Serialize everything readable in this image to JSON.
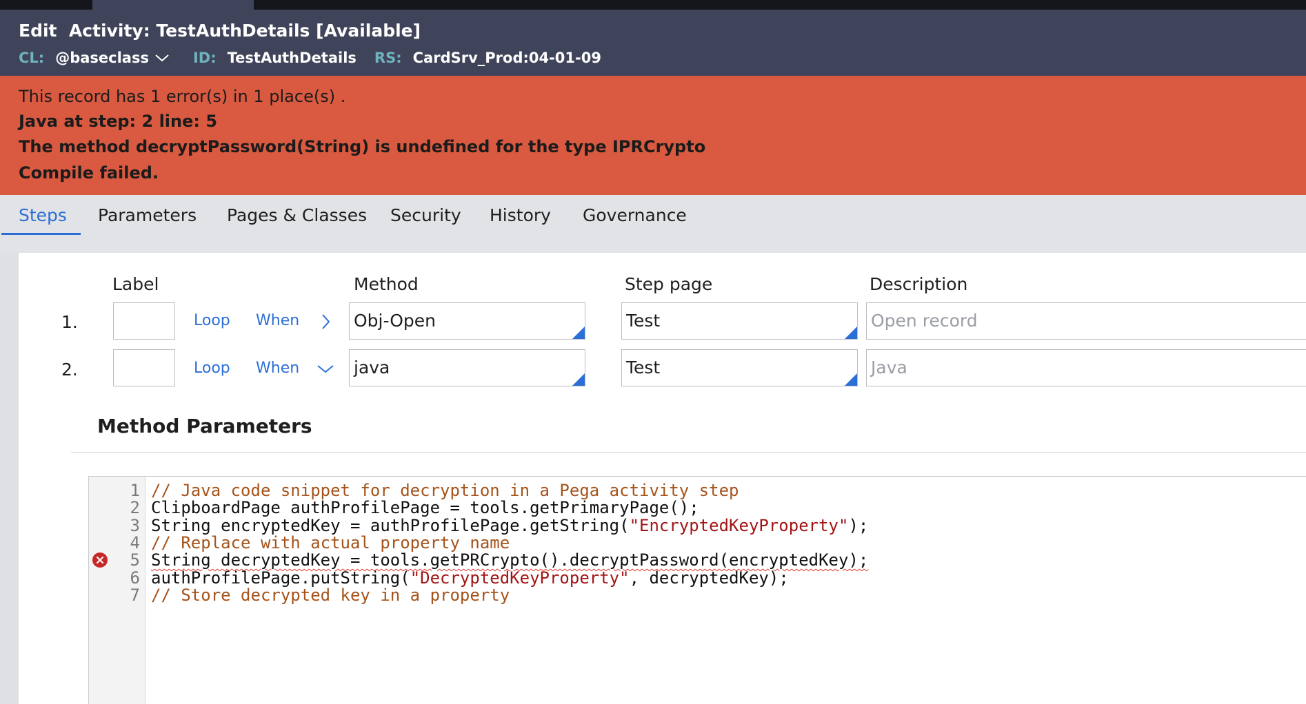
{
  "header": {
    "edit_label": "Edit",
    "record_type": "Activity:",
    "record_name": "TestAuthDetails",
    "status": "[Available]",
    "cl_key": "CL:",
    "cl_value": "@baseclass",
    "id_key": "ID:",
    "id_value": "TestAuthDetails",
    "rs_key": "RS:",
    "rs_value": "CardSrv_Prod:04-01-09"
  },
  "error_banner": {
    "summary": "This record has 1 error(s) in 1 place(s) .",
    "location": "Java at step: 2 line: 5",
    "message": "The method decryptPassword(String) is undefined for the type IPRCrypto",
    "result": "Compile failed."
  },
  "tabs": [
    "Steps",
    "Parameters",
    "Pages & Classes",
    "Security",
    "History",
    "Governance"
  ],
  "active_tab": "Steps",
  "columns": {
    "label": "Label",
    "method": "Method",
    "step_page": "Step page",
    "description": "Description"
  },
  "steps": [
    {
      "num": "1.",
      "loop": "Loop",
      "when": "When",
      "method": "Obj-Open",
      "step_page": "Test",
      "description": "Open record",
      "expanded": false
    },
    {
      "num": "2.",
      "loop": "Loop",
      "when": "When",
      "method": "java",
      "step_page": "Test",
      "description": "Java",
      "expanded": true
    }
  ],
  "method_parameters": {
    "title": "Method Parameters",
    "code_lines": [
      {
        "n": "1",
        "segments": [
          {
            "t": "// Java code snippet for decryption in a Pega activity step",
            "c": "com"
          }
        ]
      },
      {
        "n": "2",
        "segments": [
          {
            "t": "ClipboardPage authProfilePage = tools.getPrimaryPage();",
            "c": "norm"
          }
        ]
      },
      {
        "n": "3",
        "segments": [
          {
            "t": "String encryptedKey = authProfilePage.getString(",
            "c": "norm"
          },
          {
            "t": "\"EncryptedKeyProperty\"",
            "c": "str"
          },
          {
            "t": ");",
            "c": "norm"
          }
        ]
      },
      {
        "n": "4",
        "segments": [
          {
            "t": "// Replace with actual property name",
            "c": "com"
          }
        ]
      },
      {
        "n": "5",
        "error": true,
        "segments": [
          {
            "t": "String decryptedKey = tools.getPRCrypto().decryptPassword(encryptedKey);",
            "c": "norm"
          }
        ]
      },
      {
        "n": "6",
        "segments": [
          {
            "t": "authProfilePage.putString(",
            "c": "norm"
          },
          {
            "t": "\"DecryptedKeyProperty\"",
            "c": "str"
          },
          {
            "t": ", decryptedKey);",
            "c": "norm"
          }
        ]
      },
      {
        "n": "7",
        "segments": [
          {
            "t": "// Store decrypted key in a property",
            "c": "com"
          }
        ]
      }
    ]
  },
  "colors": {
    "header_bg": "#40445a",
    "error_bg": "#d95a40",
    "accent": "#2b6fd6",
    "meta_key": "#6fb3bd"
  }
}
